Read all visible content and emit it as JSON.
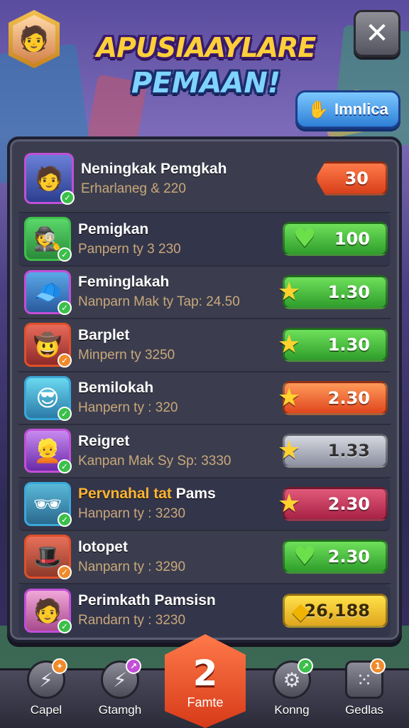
{
  "header": {
    "title_line1": "APUSIAAYLARE",
    "title_line2": "PEMAAN!",
    "invite_label": "Imnlica"
  },
  "rows": [
    {
      "name": "Neningkak Pemgkah",
      "sub": "Erharlaneg & 220",
      "value": "30",
      "icon": "none",
      "color": "first"
    },
    {
      "name": "Pemigkan",
      "sub": "Panpern ty 3 230",
      "value": "100",
      "icon": "heart-icon",
      "color": "green"
    },
    {
      "name": "Feminglakah",
      "sub": "Nanparn Mak ty Tap: 24.50",
      "value": "1.30",
      "icon": "star-icon",
      "color": "green"
    },
    {
      "name": "Barplet",
      "sub": "Minpern ty 3250",
      "value": "1.30",
      "icon": "star-icon",
      "color": "green"
    },
    {
      "name": "Bemilokah",
      "sub": "Hanpern ty : 320",
      "value": "2.30",
      "icon": "star-icon",
      "color": "orange"
    },
    {
      "name": "Reigret",
      "sub": "Kanpan Mak Sy Sp: 3330",
      "value": "1.33",
      "icon": "star-icon",
      "color": "grey"
    },
    {
      "name_gold": "Pervnahal tat",
      "name_rest": "Pams",
      "sub": "Hanparn ty : 3230",
      "value": "2.30",
      "icon": "star-icon",
      "color": "crimson"
    },
    {
      "name": "lotopet",
      "sub": "Nanparn ty : 3290",
      "value": "2.30",
      "icon": "heart-icon",
      "color": "green"
    },
    {
      "name": "Perimkath Pamsisn",
      "sub": "Randarn ty : 3230",
      "value": "26,188",
      "icon": "gem-icon",
      "color": "gold"
    }
  ],
  "nav": {
    "items": [
      {
        "label": "Capel"
      },
      {
        "label": "Gtamgh"
      },
      {
        "label": "Famte",
        "number": "2"
      },
      {
        "label": "Konng"
      },
      {
        "label": "Gedlas",
        "badge": "1"
      }
    ]
  }
}
